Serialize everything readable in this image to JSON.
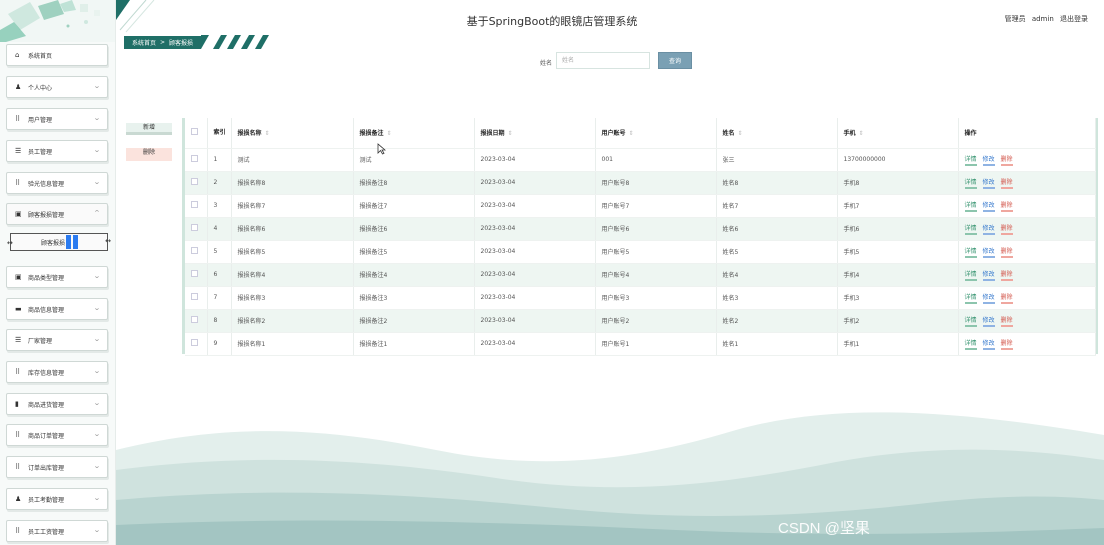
{
  "app": {
    "title": "基于SpringBoot的眼镜店管理系统",
    "user_role": "管理员",
    "username": "admin",
    "logout": "退出登录"
  },
  "breadcrumb": {
    "home": "系统首页",
    "separator": ">",
    "current": "顾客报损"
  },
  "sidebar": {
    "items": [
      {
        "label": "系统首页",
        "icon": "home-icon",
        "glyph": "⌂",
        "chevron": false
      },
      {
        "label": "个人中心",
        "icon": "user-icon",
        "glyph": "♟",
        "chevron": true
      },
      {
        "label": "用户管理",
        "icon": "grid-icon",
        "glyph": "⠿",
        "chevron": true
      },
      {
        "label": "员工管理",
        "icon": "list-icon",
        "glyph": "☰",
        "chevron": true
      },
      {
        "label": "验光信息管理",
        "icon": "grid-icon",
        "glyph": "⠿",
        "chevron": true
      },
      {
        "label": "顾客报损管理",
        "icon": "lock-icon",
        "glyph": "▣",
        "chevron": true,
        "expanded": true
      },
      {
        "label": "商品类型管理",
        "icon": "lock-icon",
        "glyph": "▣",
        "chevron": true
      },
      {
        "label": "商品信息管理",
        "icon": "monitor-icon",
        "glyph": "▬",
        "chevron": true
      },
      {
        "label": "厂家管理",
        "icon": "list-icon",
        "glyph": "☰",
        "chevron": true
      },
      {
        "label": "库存信息管理",
        "icon": "grid-icon",
        "glyph": "⠿",
        "chevron": true
      },
      {
        "label": "商品进货管理",
        "icon": "bar-chart-icon",
        "glyph": "▮",
        "chevron": true
      },
      {
        "label": "商品订单管理",
        "icon": "grid-icon",
        "glyph": "⠿",
        "chevron": true
      },
      {
        "label": "订单出库管理",
        "icon": "grid-icon",
        "glyph": "⠿",
        "chevron": true
      },
      {
        "label": "员工考勤管理",
        "icon": "user-icon",
        "glyph": "♟",
        "chevron": true
      },
      {
        "label": "员工工资管理",
        "icon": "grid-icon",
        "glyph": "⠿",
        "chevron": true
      }
    ],
    "submenu_label": "顾客报损"
  },
  "search": {
    "label": "姓名",
    "placeholder": "姓名",
    "button": "查询"
  },
  "actions": {
    "add": "新增",
    "delete": "删除"
  },
  "table": {
    "headers": [
      "索引",
      "报损名称",
      "报损备注",
      "报损日期",
      "用户账号",
      "姓名",
      "手机",
      "操作"
    ],
    "sort_glyph": "⇕",
    "ops": {
      "detail": "详情",
      "edit": "修改",
      "delete": "删除"
    },
    "rows": [
      {
        "index": "1",
        "name": "测试",
        "note": "测试",
        "date": "2023-03-04",
        "account": "001",
        "person": "张三",
        "phone": "13700000000"
      },
      {
        "index": "2",
        "name": "报损名称8",
        "note": "报损备注8",
        "date": "2023-03-04",
        "account": "用户账号8",
        "person": "姓名8",
        "phone": "手机8"
      },
      {
        "index": "3",
        "name": "报损名称7",
        "note": "报损备注7",
        "date": "2023-03-04",
        "account": "用户账号7",
        "person": "姓名7",
        "phone": "手机7"
      },
      {
        "index": "4",
        "name": "报损名称6",
        "note": "报损备注6",
        "date": "2023-03-04",
        "account": "用户账号6",
        "person": "姓名6",
        "phone": "手机6"
      },
      {
        "index": "5",
        "name": "报损名称5",
        "note": "报损备注5",
        "date": "2023-03-04",
        "account": "用户账号5",
        "person": "姓名5",
        "phone": "手机5"
      },
      {
        "index": "6",
        "name": "报损名称4",
        "note": "报损备注4",
        "date": "2023-03-04",
        "account": "用户账号4",
        "person": "姓名4",
        "phone": "手机4"
      },
      {
        "index": "7",
        "name": "报损名称3",
        "note": "报损备注3",
        "date": "2023-03-04",
        "account": "用户账号3",
        "person": "姓名3",
        "phone": "手机3"
      },
      {
        "index": "8",
        "name": "报损名称2",
        "note": "报损备注2",
        "date": "2023-03-04",
        "account": "用户账号2",
        "person": "姓名2",
        "phone": "手机2"
      },
      {
        "index": "9",
        "name": "报损名称1",
        "note": "报损备注1",
        "date": "2023-03-04",
        "account": "用户账号1",
        "person": "姓名1",
        "phone": "手机1"
      }
    ]
  },
  "watermark": "CSDN @坚果"
}
